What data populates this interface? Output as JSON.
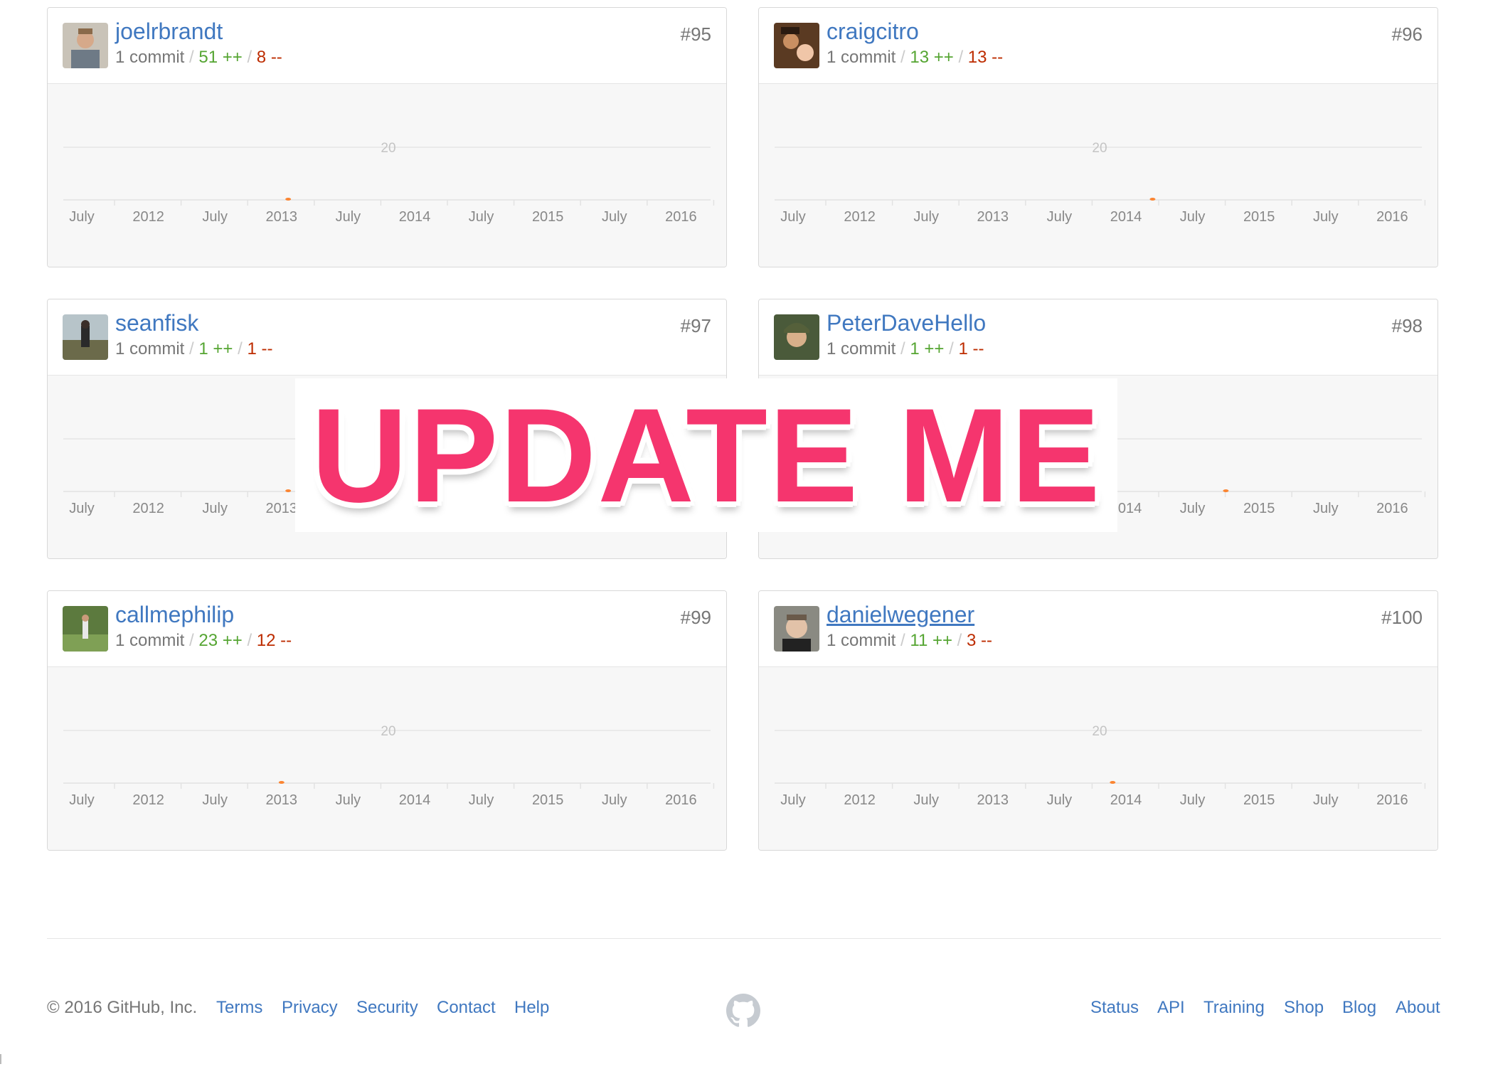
{
  "contributors": [
    {
      "username": "joelrbrandt",
      "rank": "#95",
      "commits": "1 commit",
      "additions": "51 ++",
      "deletions": "8 --",
      "avatar": "avatar-joelrbrandt",
      "dot_date": 2013.05
    },
    {
      "username": "craigcitro",
      "rank": "#96",
      "commits": "1 commit",
      "additions": "13 ++",
      "deletions": "13 --",
      "avatar": "avatar-craigcitro",
      "dot_date": 2014.2
    },
    {
      "username": "seanfisk",
      "rank": "#97",
      "commits": "1 commit",
      "additions": "1 ++",
      "deletions": "1 --",
      "avatar": "avatar-seanfisk",
      "dot_date": 2013.05
    },
    {
      "username": "PeterDaveHello",
      "rank": "#98",
      "commits": "1 commit",
      "additions": "1 ++",
      "deletions": "1 --",
      "avatar": "avatar-peterdavehello",
      "dot_date": 2014.75
    },
    {
      "username": "callmephilip",
      "rank": "#99",
      "commits": "1 commit",
      "additions": "23 ++",
      "deletions": "12 --",
      "avatar": "avatar-callmephilip",
      "dot_date": 2013.0
    },
    {
      "username": "danielwegener",
      "rank": "#100",
      "commits": "1 commit",
      "additions": "11 ++",
      "deletions": "3 --",
      "avatar": "avatar-danielwegener",
      "dot_date": 2013.9
    }
  ],
  "chart_data": {
    "type": "area",
    "x_tick_labels": [
      "July",
      "2012",
      "July",
      "2013",
      "July",
      "2014",
      "July",
      "2015",
      "July",
      "2016"
    ],
    "y_tick_labels": [
      "20"
    ],
    "x_range": [
      "2011-07",
      "2016-07"
    ],
    "series_color": "#fb8532"
  },
  "overlay": {
    "text": "UPDATE ME"
  },
  "footer": {
    "copyright": "© 2016 GitHub, Inc.",
    "left_links": [
      "Terms",
      "Privacy",
      "Security",
      "Contact",
      "Help"
    ],
    "right_links": [
      "Status",
      "API",
      "Training",
      "Shop",
      "Blog",
      "About"
    ]
  }
}
